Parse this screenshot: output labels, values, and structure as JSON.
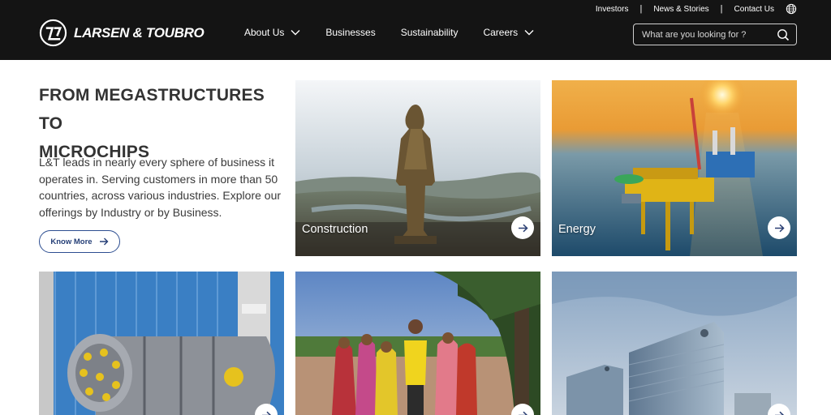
{
  "header": {
    "brand": "LARSEN & TOUBRO",
    "top_links": [
      "Investors",
      "News & Stories",
      "Contact Us"
    ],
    "nav": [
      {
        "label": "About Us",
        "dropdown": true
      },
      {
        "label": "Businesses",
        "dropdown": false
      },
      {
        "label": "Sustainability",
        "dropdown": false
      },
      {
        "label": "Careers",
        "dropdown": true
      }
    ],
    "search_placeholder": "What are you looking for ?",
    "icons": [
      "logo-icon",
      "globe-icon",
      "chevron-down-icon",
      "search-icon"
    ]
  },
  "intro": {
    "title_line1": "FROM MEGASTRUCTURES TO",
    "title_line2": "MICROCHIPS",
    "body": "L&T leads in nearly every sphere of business it operates in. Serving customers in more than 50 countries, across various industries. Explore our offerings by Industry or by Business.",
    "button": "Know More"
  },
  "cards": [
    {
      "label": "Construction"
    },
    {
      "label": "Energy"
    },
    {
      "label": ""
    },
    {
      "label": ""
    },
    {
      "label": ""
    }
  ],
  "colors": {
    "header_bg": "#141414",
    "accent": "#253f77",
    "text": "#333333"
  }
}
